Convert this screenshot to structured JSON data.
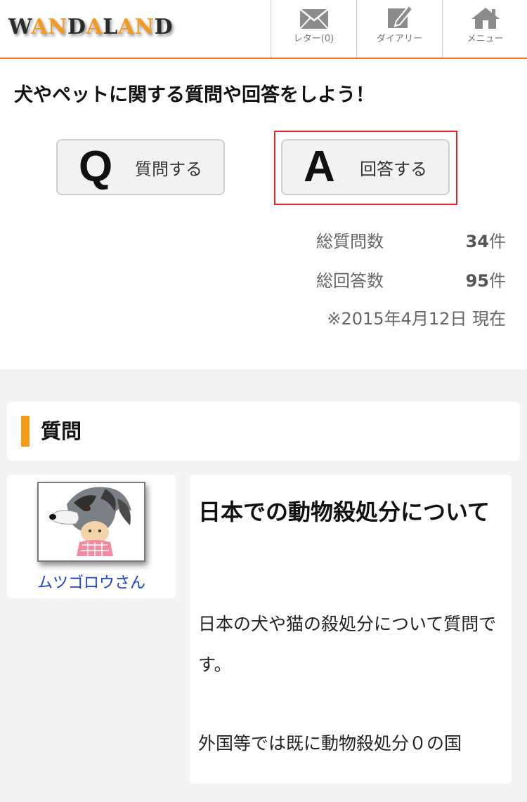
{
  "header": {
    "logo_text": "WANDALAND",
    "logo_colors": {
      "dark": "#2b2b2b",
      "orange": "#f39a1e"
    },
    "nav": [
      {
        "label": "レター(0)",
        "icon": "envelope-icon"
      },
      {
        "label": "ダイアリー",
        "icon": "pencil-note-icon"
      },
      {
        "label": "メニュー",
        "icon": "house-icon"
      }
    ],
    "accent": "#e8731c"
  },
  "intro": {
    "heading": "犬やペットに関する質問や回答をしよう！",
    "question_button": {
      "letter": "Q",
      "label": "質問する"
    },
    "answer_button": {
      "letter": "A",
      "label": "回答する"
    },
    "stats": [
      {
        "label": "総質問数",
        "value": "34",
        "unit": "件"
      },
      {
        "label": "総回答数",
        "value": "95",
        "unit": "件"
      }
    ],
    "as_of": "※2015年4月12日 現在"
  },
  "section": {
    "title": "質問",
    "bar_color": "#f49b1a"
  },
  "question": {
    "user_name": "ムツゴロウさん",
    "title": "日本での動物殺処分について",
    "body": [
      "日本の犬や猫の殺処分について質問です。",
      "外国等では既に動物殺処分０の国"
    ]
  }
}
